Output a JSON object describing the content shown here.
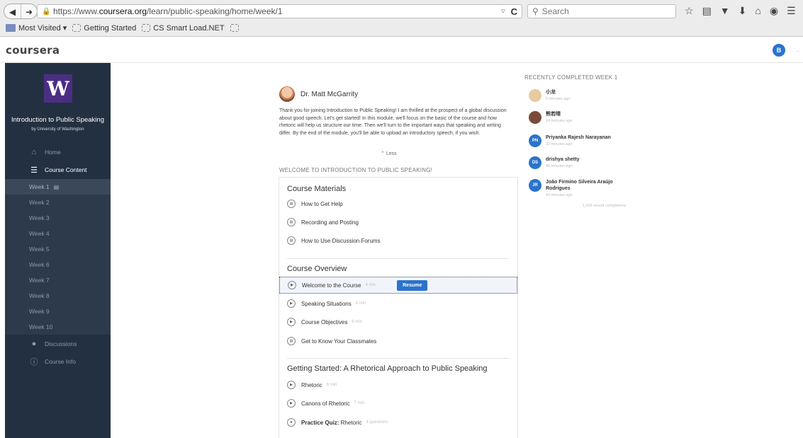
{
  "browser": {
    "url_prefix": "https://www.",
    "url_domain": "coursera.org",
    "url_path": "/learn/public-speaking/home/week/1",
    "search_placeholder": "Search",
    "bookmarks": [
      "Most Visited ▾",
      "Getting Started",
      "CS Smart Load.NET"
    ]
  },
  "header": {
    "logo": "coursera",
    "user_initial": "B"
  },
  "sidebar": {
    "course_title": "Introduction to Public Speaking",
    "course_subtitle": "by University of Washington",
    "home": "Home",
    "course_content": "Course Content",
    "weeks": [
      "Week 1",
      "Week 2",
      "Week 3",
      "Week 4",
      "Week 5",
      "Week 6",
      "Week 7",
      "Week 8",
      "Week 9",
      "Week 10"
    ],
    "discussions": "Discussions",
    "course_info": "Course Info"
  },
  "main": {
    "instructor_name": "Dr. Matt McGarrity",
    "intro": "Thank you for joining Introduction to Public Speaking! I am thrilled at the prospect of a global discussion about good speech. Let's get started! In this module, we'll focus on the basic of the course and how rhetoric will help us structure our time. Then we'll turn to the important ways that speaking and writing differ. By the end of the module, you'll be able to upload an introductory speech, if you wish.",
    "less": "Less",
    "welcome_header": "WELCOME TO INTRODUCTION TO PUBLIC SPEAKING!",
    "sections": [
      {
        "title": "Course Materials",
        "items": [
          {
            "label": "How to Get Help"
          },
          {
            "label": "Recording and Posting"
          },
          {
            "label": "How to Use Discussion Forums"
          }
        ]
      },
      {
        "title": "Course Overview",
        "items": [
          {
            "label": "Welcome to the Course",
            "duration": "4 min",
            "action": "Resume"
          },
          {
            "label": "Speaking Situations",
            "duration": "6 min"
          },
          {
            "label": "Course Objectives",
            "duration": "6 min"
          },
          {
            "label": "Get to Know Your Classmates"
          }
        ]
      },
      {
        "title": "Getting Started: A Rhetorical Approach to Public Speaking",
        "items": [
          {
            "label": "Rhetoric",
            "duration": "6 min"
          },
          {
            "label": "Canons of Rhetoric",
            "duration": "7 min"
          },
          {
            "label_bold": "Practice Quiz:",
            "label": "Rhetoric",
            "duration": "4 questions"
          }
        ]
      }
    ]
  },
  "recent": {
    "header": "RECENTLY COMPLETED WEEK 1",
    "people": [
      {
        "name": "小龙",
        "ago": "5 minutes ago",
        "initials": "",
        "color": "#e8c9a0"
      },
      {
        "name": "熊若晴",
        "ago": "14 minutes ago",
        "initials": "",
        "color": "#7b4b3a"
      },
      {
        "name": "Priyanka Rajesh Narayanan",
        "ago": "32 minutes ago",
        "initials": "PN",
        "color": "#2a73cc"
      },
      {
        "name": "drishya shetty",
        "ago": "40 minutes ago",
        "initials": "DS",
        "color": "#2a73cc"
      },
      {
        "name": "João Firmino Silveira Araújo Rodrigues",
        "ago": "43 minutes ago",
        "initials": "JR",
        "color": "#2a73cc"
      }
    ],
    "footer": "1,636 recent completions"
  }
}
